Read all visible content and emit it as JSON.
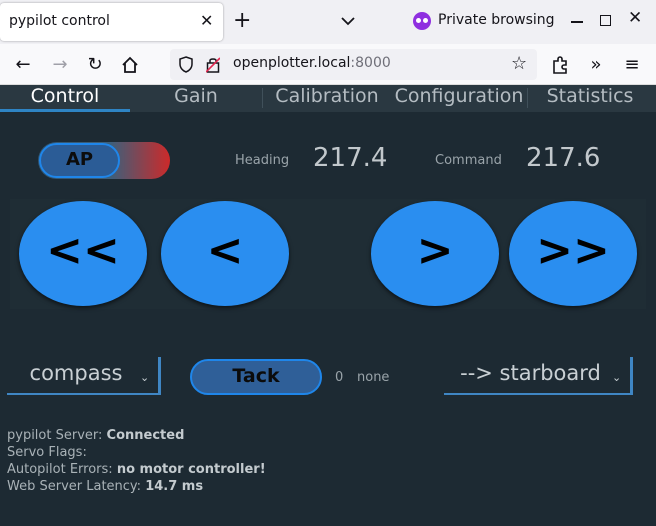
{
  "browser": {
    "tab_title": "pypilot control",
    "private_label": "Private browsing",
    "url_host": "openplotter.local",
    "url_port": ":8000"
  },
  "nav": {
    "tabs": [
      {
        "label": "Control"
      },
      {
        "label": "Gain"
      },
      {
        "label": "Calibration"
      },
      {
        "label": "Configuration"
      },
      {
        "label": "Statistics"
      }
    ]
  },
  "control": {
    "ap_label": "AP",
    "heading_label": "Heading",
    "heading_value": "217.4",
    "command_label": "Command",
    "command_value": "217.6",
    "steer": {
      "port_big": "<<",
      "port_small": "<",
      "stbd_small": ">",
      "stbd_big": ">>"
    },
    "mode_select": "compass",
    "tack_label": "Tack",
    "tack_count": "0",
    "tack_state": "none",
    "tack_direction": "--> starboard"
  },
  "status": {
    "server_label": "pypilot Server:",
    "server_value": "Connected",
    "servo_flags_label": "Servo Flags:",
    "servo_flags_value": "",
    "errors_label": "Autopilot Errors:",
    "errors_value": "no motor controller!",
    "latency_label": "Web Server Latency:",
    "latency_value": "14.7 ms"
  }
}
